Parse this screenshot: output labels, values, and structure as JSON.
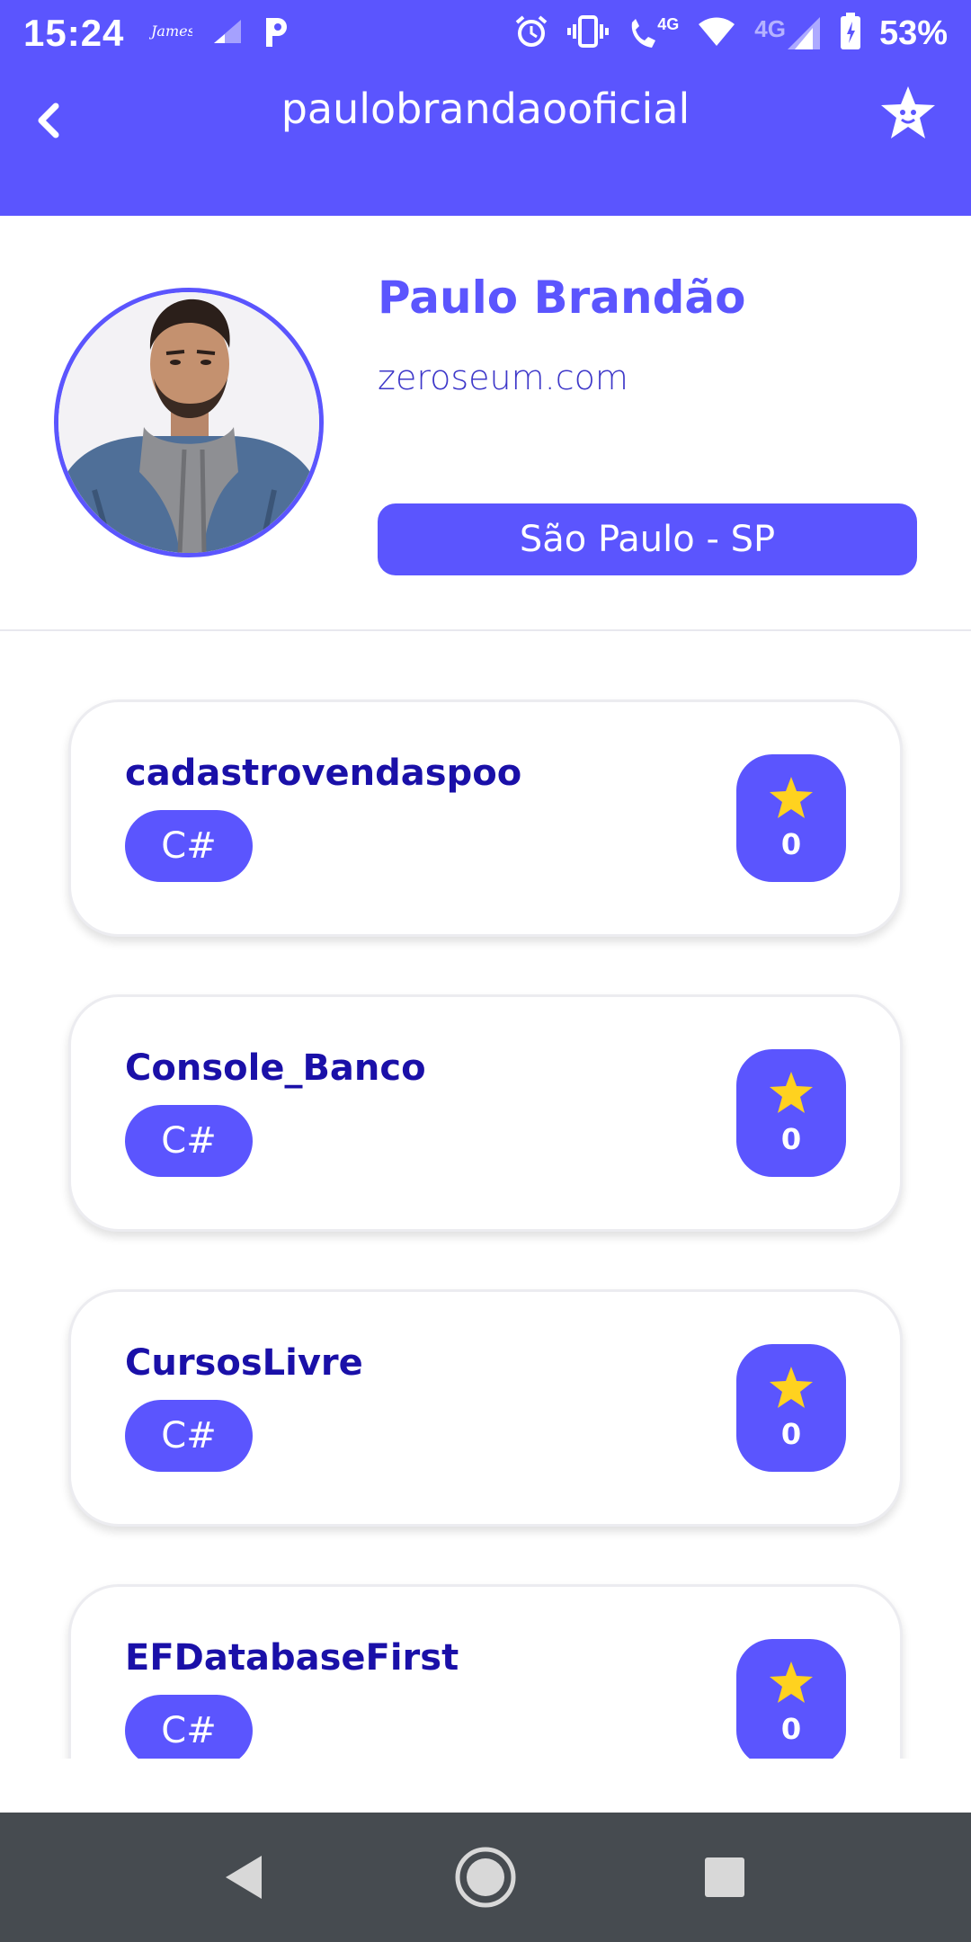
{
  "status_bar": {
    "time": "15:24",
    "battery_percent": "53%",
    "network_labels": [
      "4G",
      "4G"
    ],
    "icons": [
      "james-app-icon",
      "signal-weak-icon",
      "p-app-icon",
      "alarm-icon",
      "vibrate-icon",
      "wifi-calling-icon",
      "wifi-icon",
      "cell-signal-icon",
      "battery-icon"
    ]
  },
  "app_bar": {
    "title": "paulobrandaooficial",
    "back_icon": "chevron-left-icon",
    "favorite_icon": "star-face-icon"
  },
  "profile": {
    "name": "Paulo Brandão",
    "website": "zeroseum.com",
    "location": "São Paulo - SP"
  },
  "repositories": [
    {
      "name": "cadastrovendaspoo",
      "language": "C#",
      "stars": "0"
    },
    {
      "name": "Console_Banco",
      "language": "C#",
      "stars": "0"
    },
    {
      "name": "CursosLivre",
      "language": "C#",
      "stars": "0"
    },
    {
      "name": "EFDatabaseFirst",
      "language": "C#",
      "stars": "0"
    }
  ],
  "colors": {
    "primary": "#5b55fe",
    "repo_title": "#1a10a8",
    "star": "#ffd21f",
    "nav_bar": "#464b50"
  },
  "nav_bar": {
    "icons": [
      "back-triangle-icon",
      "home-circle-icon",
      "recents-square-icon"
    ]
  }
}
